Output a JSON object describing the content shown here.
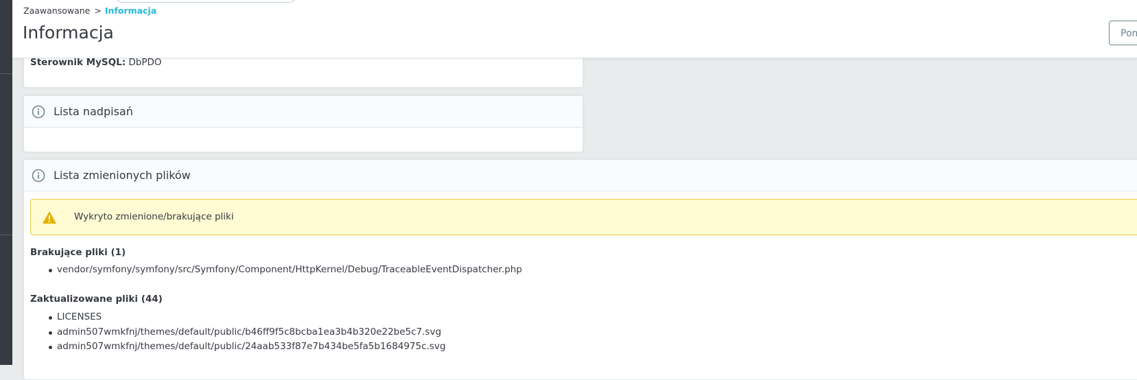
{
  "breadcrumb": {
    "parent": "Zaawansowane",
    "separator": ">",
    "current": "Informacja"
  },
  "page_title": "Informacja",
  "toolbar": {
    "button_label": "Pom"
  },
  "database": {
    "driver_label": "Sterownik MySQL:",
    "driver_value": "DbPDO"
  },
  "overrides_card": {
    "title": "Lista nadpisań",
    "icon": "info-icon"
  },
  "changed_files_card": {
    "title": "Lista zmienionych plików",
    "icon": "info-icon",
    "alert": {
      "icon": "warning-icon",
      "text": "Wykryto zmienione/brakujące pliki"
    },
    "missing": {
      "title": "Brakujące pliki (1)",
      "items": [
        "vendor/symfony/symfony/src/Symfony/Component/HttpKernel/Debug/TraceableEventDispatcher.php"
      ]
    },
    "updated": {
      "title": "Zaktualizowane pliki (44)",
      "items": [
        "LICENSES",
        "admin507wmkfnj/themes/default/public/b46ff9f5c8bcba1ea3b4b320e22be5c7.svg",
        "admin507wmkfnj/themes/default/public/24aab533f87e7b434be5fa5b1684975c.svg"
      ]
    }
  },
  "colors": {
    "accent": "#25b9d7",
    "sidebar": "#363a41",
    "alert_bg": "#fffbd3",
    "alert_border": "#e5c94a",
    "warning": "#e2b100"
  }
}
